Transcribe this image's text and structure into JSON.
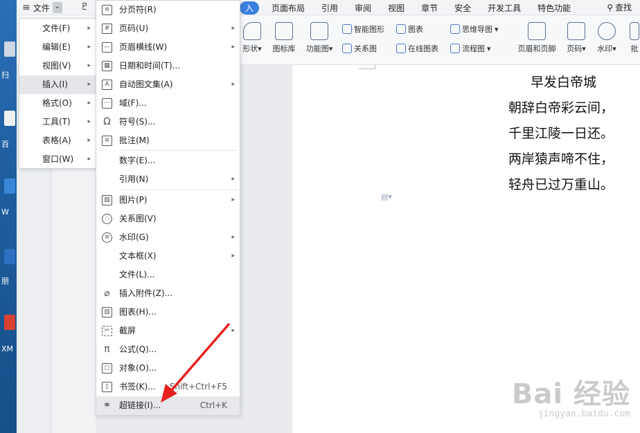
{
  "desktop": {
    "labels": [
      "扫",
      "百",
      "W",
      "朋",
      "XM"
    ]
  },
  "topbar": {
    "file_label": "文件",
    "tabs": [
      "入",
      "页面布局",
      "引用",
      "审阅",
      "视图",
      "章节",
      "安全",
      "开发工具",
      "特色功能"
    ],
    "search_label": "查找"
  },
  "ribbon": {
    "items": [
      "形状",
      "图标库",
      "功能图",
      "智能图形",
      "图表",
      "思维导图",
      "关系图",
      "在线图表",
      "流程图",
      "页眉和页脚",
      "页码",
      "水印",
      "批"
    ]
  },
  "menu_main": {
    "items": [
      {
        "label": "文件(F)",
        "arrow": "▸"
      },
      {
        "label": "编辑(E)",
        "arrow": "▸"
      },
      {
        "label": "视图(V)",
        "arrow": "▸"
      },
      {
        "label": "插入(I)",
        "arrow": "▸"
      },
      {
        "label": "格式(O)",
        "arrow": "▸"
      },
      {
        "label": "工具(T)",
        "arrow": "▸"
      },
      {
        "label": "表格(A)",
        "arrow": "▸"
      },
      {
        "label": "窗口(W)",
        "arrow": "▸"
      }
    ]
  },
  "menu_insert": {
    "items": [
      {
        "label": "分页符(R)",
        "icon": "page-break-icon"
      },
      {
        "label": "页码(U)",
        "icon": "page-number-icon",
        "arrow": "▸"
      },
      {
        "label": "页眉横线(W)",
        "icon": "header-line-icon",
        "arrow": "▸"
      },
      {
        "label": "日期和时间(T)...",
        "icon": "calendar-icon"
      },
      {
        "label": "自动图文集(A)",
        "icon": "autotext-icon",
        "arrow": "▸"
      },
      {
        "label": "域(F)...",
        "icon": "field-icon"
      },
      {
        "label": "符号(S)...",
        "icon": "omega-icon"
      },
      {
        "label": "批注(M)",
        "icon": "comment-icon"
      },
      {
        "label": "数字(E)..."
      },
      {
        "label": "引用(N)",
        "arrow": "▸"
      },
      {
        "label": "图片(P)",
        "icon": "picture-icon",
        "arrow": "▸"
      },
      {
        "label": "关系图(V)",
        "icon": "relation-icon"
      },
      {
        "label": "水印(G)",
        "icon": "watermark-icon",
        "arrow": "▸"
      },
      {
        "label": "文本框(X)",
        "arrow": "▸"
      },
      {
        "label": "文件(L)..."
      },
      {
        "label": "插入附件(Z)...",
        "icon": "paperclip-icon"
      },
      {
        "label": "图表(H)...",
        "icon": "chart-icon"
      },
      {
        "label": "截屏",
        "icon": "screenshot-icon",
        "arrow": "▸"
      },
      {
        "label": "公式(Q)...",
        "icon": "pi-icon"
      },
      {
        "label": "对象(O)...",
        "icon": "object-icon"
      },
      {
        "label": "书签(K)...",
        "icon": "bookmark-icon",
        "shortcut": "Shift+Ctrl+F5"
      },
      {
        "label": "超链接(I)...",
        "icon": "link-icon",
        "shortcut": "Ctrl+K"
      }
    ]
  },
  "document": {
    "title": "早发白帝城",
    "lines": [
      "朝辞白帝彩云间，",
      "千里江陵一日还。",
      "两岸猿声啼不住，",
      "轻舟已过万重山。"
    ]
  },
  "watermark": {
    "big": "Bai 经验",
    "small": "jingyan.baidu.com"
  },
  "colors": {
    "accent": "#3b7fe0",
    "arrow": "#e8211f"
  }
}
